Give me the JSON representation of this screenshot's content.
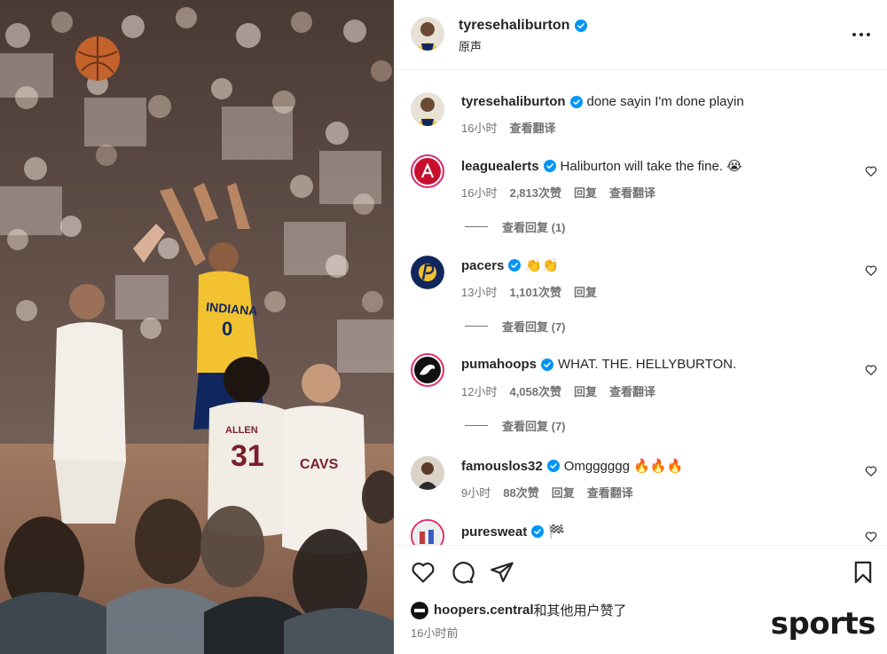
{
  "header": {
    "username": "tyresehaliburton",
    "audio_label": "原声"
  },
  "caption": {
    "username": "tyresehaliburton",
    "text": "done sayin I'm done playin",
    "time": "16小时",
    "translate": "查看翻译"
  },
  "comments": [
    {
      "username": "leaguealerts",
      "text": "Haliburton will take the fine. 😭",
      "time": "16小时",
      "likes": "2,813次赞",
      "reply": "回复",
      "translate": "查看翻译",
      "view_replies": "查看回复 (1)"
    },
    {
      "username": "pacers",
      "text": "👏👏",
      "time": "13小时",
      "likes": "1,101次赞",
      "reply": "回复",
      "view_replies": "查看回复 (7)"
    },
    {
      "username": "pumahoops",
      "text": "WHAT. THE. HELLYBURTON.",
      "time": "12小时",
      "likes": "4,058次赞",
      "reply": "回复",
      "translate": "查看翻译",
      "view_replies": "查看回复 (7)"
    },
    {
      "username": "famouslos32",
      "text": "Omgggggg 🔥🔥🔥",
      "time": "9小时",
      "likes": "88次赞",
      "reply": "回复",
      "translate": "查看翻译"
    },
    {
      "username": "puresweat",
      "text": "🏁"
    }
  ],
  "footer": {
    "liked_by_user": "hoopers.central",
    "liked_by_suffix": "和其他用户赞了",
    "posted_time": "16小时前",
    "watermark": "sports"
  },
  "media": {
    "jersey_team": "INDIANA",
    "jersey_number": "0",
    "defender_name": "ALLEN",
    "defender_number": "31",
    "defender2_text": "CAVS"
  },
  "colors": {
    "verified": "#0095f6",
    "text": "#262626",
    "secondary": "#737373",
    "pacers_yellow": "#f2c230",
    "pacers_navy": "#12265e"
  }
}
